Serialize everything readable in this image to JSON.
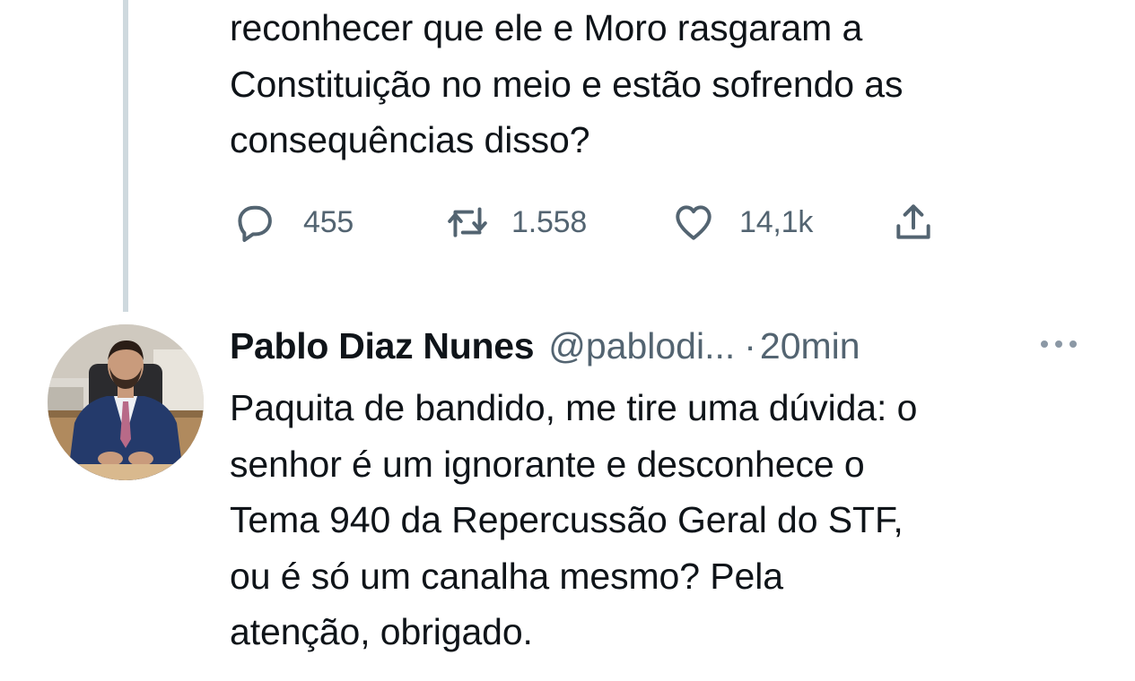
{
  "previous_tweet": {
    "text_lines": [
      "reconhecer que ele e Moro rasgaram a",
      "Constituição no meio e estão sofrendo as",
      "consequências disso?"
    ],
    "actions": {
      "replies": "455",
      "retweets": "1.558",
      "likes": "14,1k"
    },
    "icons": {
      "reply": "reply-icon",
      "retweet": "retweet-icon",
      "like": "heart-icon",
      "share": "share-icon"
    }
  },
  "reply_tweet": {
    "display_name": "Pablo Diaz Nunes",
    "handle": "@pablodi...",
    "separator": "·",
    "timestamp": "20min",
    "text_lines": [
      "Paquita de bandido, me tire uma dúvida: o",
      "senhor é um ignorante e desconhece o",
      "Tema 940 da Repercussão Geral do STF,",
      "ou é só um canalha mesmo? Pela",
      "atenção, obrigado."
    ],
    "more_icon": "more-horizontal-icon"
  },
  "colors": {
    "text_primary": "#0f1419",
    "text_secondary": "#536471",
    "thread_line": "#cfd9de",
    "background": "#ffffff"
  }
}
